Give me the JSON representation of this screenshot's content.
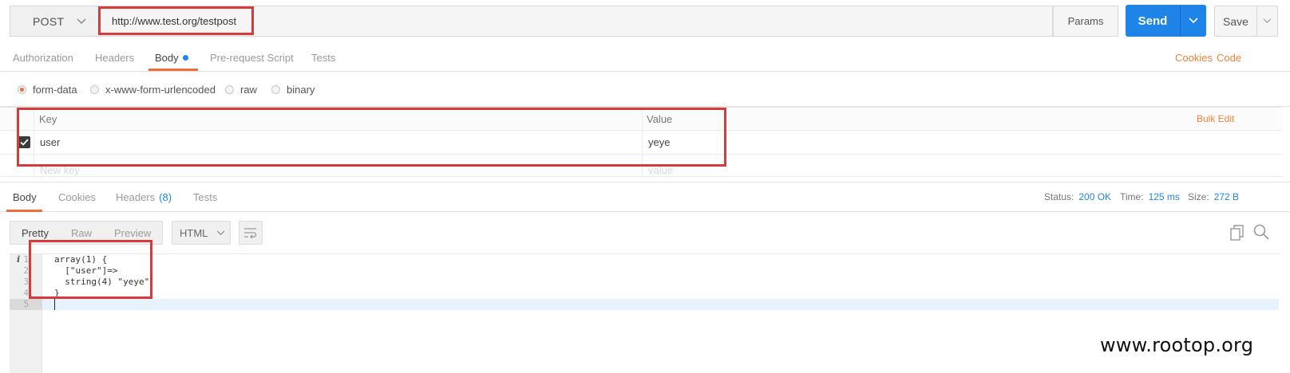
{
  "request": {
    "method": "POST",
    "url": "http://www.test.org/testpost",
    "params_label": "Params",
    "send_label": "Send",
    "save_label": "Save"
  },
  "request_tabs": {
    "authorization": "Authorization",
    "headers": "Headers",
    "body": "Body",
    "prerequest": "Pre-request Script",
    "tests": "Tests",
    "cookies": "Cookies",
    "code": "Code"
  },
  "body_modes": {
    "form_data": "form-data",
    "urlencoded": "x-www-form-urlencoded",
    "raw": "raw",
    "binary": "binary",
    "selected": "form-data"
  },
  "kv_table": {
    "key_header": "Key",
    "value_header": "Value",
    "bulk_edit": "Bulk Edit",
    "rows": [
      {
        "checked": true,
        "key": "user",
        "value": "yeye"
      }
    ],
    "new_key_placeholder": "New key",
    "new_value_placeholder": "value"
  },
  "response_tabs": {
    "body": "Body",
    "cookies": "Cookies",
    "headers": "Headers",
    "headers_count": "(8)",
    "tests": "Tests"
  },
  "response_meta": {
    "status_label": "Status:",
    "status_value": "200 OK",
    "time_label": "Time:",
    "time_value": "125 ms",
    "size_label": "Size:",
    "size_value": "272 B"
  },
  "response_tools": {
    "pretty": "Pretty",
    "raw": "Raw",
    "preview": "Preview",
    "language": "HTML"
  },
  "editor": {
    "info_marker": "i",
    "line_numbers": [
      "1",
      "2",
      "3",
      "4",
      "5"
    ],
    "lines": [
      "array(1) {",
      "  [\"user\"]=>",
      "  string(4) \"yeye\"",
      "}",
      ""
    ]
  },
  "watermark": "www.rootop.org",
  "colors": {
    "accent_orange": "#f26b3a",
    "send_blue": "#1e84e8",
    "highlight_red": "#d73a3a"
  },
  "icons": [
    "chevron-down-icon",
    "check-icon",
    "wrap-lines-icon",
    "copy-icon",
    "search-icon"
  ]
}
